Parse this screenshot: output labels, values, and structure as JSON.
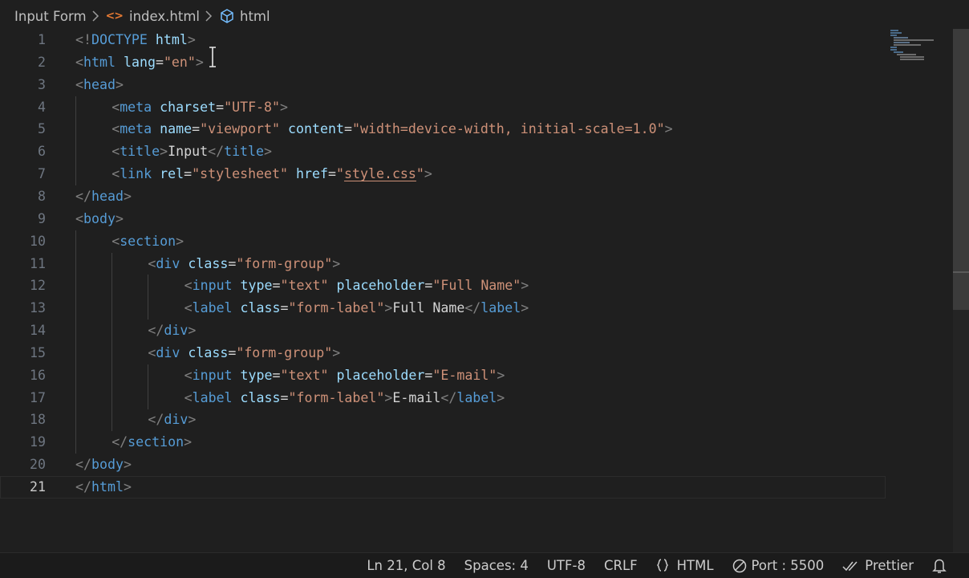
{
  "breadcrumb": {
    "folder": "Input Form",
    "file": "index.html",
    "file_icon": "<>",
    "symbol": "html"
  },
  "editor": {
    "current_line": 21,
    "lines": [
      {
        "n": "1",
        "indent": 0,
        "tokens": [
          {
            "c": "t",
            "v": "<!"
          },
          {
            "c": "dt",
            "v": "DOCTYPE"
          },
          {
            "c": "x",
            "v": " "
          },
          {
            "c": "a",
            "v": "html"
          },
          {
            "c": "t",
            "v": ">"
          }
        ]
      },
      {
        "n": "2",
        "indent": 0,
        "tokens": [
          {
            "c": "t",
            "v": "<"
          },
          {
            "c": "k",
            "v": "html"
          },
          {
            "c": "x",
            "v": " "
          },
          {
            "c": "a",
            "v": "lang"
          },
          {
            "c": "e",
            "v": "="
          },
          {
            "c": "s",
            "v": "\"en\""
          },
          {
            "c": "t",
            "v": ">"
          }
        ]
      },
      {
        "n": "3",
        "indent": 0,
        "tokens": [
          {
            "c": "t",
            "v": "<"
          },
          {
            "c": "k",
            "v": "head"
          },
          {
            "c": "t",
            "v": ">"
          }
        ]
      },
      {
        "n": "4",
        "indent": 1,
        "tokens": [
          {
            "c": "t",
            "v": "<"
          },
          {
            "c": "k",
            "v": "meta"
          },
          {
            "c": "x",
            "v": " "
          },
          {
            "c": "a",
            "v": "charset"
          },
          {
            "c": "e",
            "v": "="
          },
          {
            "c": "s",
            "v": "\"UTF-8\""
          },
          {
            "c": "t",
            "v": ">"
          }
        ]
      },
      {
        "n": "5",
        "indent": 1,
        "tokens": [
          {
            "c": "t",
            "v": "<"
          },
          {
            "c": "k",
            "v": "meta"
          },
          {
            "c": "x",
            "v": " "
          },
          {
            "c": "a",
            "v": "name"
          },
          {
            "c": "e",
            "v": "="
          },
          {
            "c": "s",
            "v": "\"viewport\""
          },
          {
            "c": "x",
            "v": " "
          },
          {
            "c": "a",
            "v": "content"
          },
          {
            "c": "e",
            "v": "="
          },
          {
            "c": "s",
            "v": "\"width=device-width, initial-scale=1.0\""
          },
          {
            "c": "t",
            "v": ">"
          }
        ]
      },
      {
        "n": "6",
        "indent": 1,
        "tokens": [
          {
            "c": "t",
            "v": "<"
          },
          {
            "c": "k",
            "v": "title"
          },
          {
            "c": "t",
            "v": ">"
          },
          {
            "c": "x",
            "v": "Input"
          },
          {
            "c": "t",
            "v": "</"
          },
          {
            "c": "k",
            "v": "title"
          },
          {
            "c": "t",
            "v": ">"
          }
        ]
      },
      {
        "n": "7",
        "indent": 1,
        "tokens": [
          {
            "c": "t",
            "v": "<"
          },
          {
            "c": "k",
            "v": "link"
          },
          {
            "c": "x",
            "v": " "
          },
          {
            "c": "a",
            "v": "rel"
          },
          {
            "c": "e",
            "v": "="
          },
          {
            "c": "s",
            "v": "\"stylesheet\""
          },
          {
            "c": "x",
            "v": " "
          },
          {
            "c": "a",
            "v": "href"
          },
          {
            "c": "e",
            "v": "="
          },
          {
            "c": "s",
            "v": "\""
          },
          {
            "c": "s u",
            "v": "style.css"
          },
          {
            "c": "s",
            "v": "\""
          },
          {
            "c": "t",
            "v": ">"
          }
        ]
      },
      {
        "n": "8",
        "indent": 0,
        "tokens": [
          {
            "c": "t",
            "v": "</"
          },
          {
            "c": "k",
            "v": "head"
          },
          {
            "c": "t",
            "v": ">"
          }
        ]
      },
      {
        "n": "9",
        "indent": 0,
        "tokens": [
          {
            "c": "t",
            "v": "<"
          },
          {
            "c": "k",
            "v": "body"
          },
          {
            "c": "t",
            "v": ">"
          }
        ]
      },
      {
        "n": "10",
        "indent": 1,
        "tokens": [
          {
            "c": "t",
            "v": "<"
          },
          {
            "c": "k",
            "v": "section"
          },
          {
            "c": "t",
            "v": ">"
          }
        ]
      },
      {
        "n": "11",
        "indent": 2,
        "tokens": [
          {
            "c": "t",
            "v": "<"
          },
          {
            "c": "k",
            "v": "div"
          },
          {
            "c": "x",
            "v": " "
          },
          {
            "c": "a",
            "v": "class"
          },
          {
            "c": "e",
            "v": "="
          },
          {
            "c": "s",
            "v": "\"form-group\""
          },
          {
            "c": "t",
            "v": ">"
          }
        ]
      },
      {
        "n": "12",
        "indent": 3,
        "tokens": [
          {
            "c": "t",
            "v": "<"
          },
          {
            "c": "k",
            "v": "input"
          },
          {
            "c": "x",
            "v": " "
          },
          {
            "c": "a",
            "v": "type"
          },
          {
            "c": "e",
            "v": "="
          },
          {
            "c": "s",
            "v": "\"text\""
          },
          {
            "c": "x",
            "v": " "
          },
          {
            "c": "a",
            "v": "placeholder"
          },
          {
            "c": "e",
            "v": "="
          },
          {
            "c": "s",
            "v": "\"Full Name\""
          },
          {
            "c": "t",
            "v": ">"
          }
        ]
      },
      {
        "n": "13",
        "indent": 3,
        "tokens": [
          {
            "c": "t",
            "v": "<"
          },
          {
            "c": "k",
            "v": "label"
          },
          {
            "c": "x",
            "v": " "
          },
          {
            "c": "a",
            "v": "class"
          },
          {
            "c": "e",
            "v": "="
          },
          {
            "c": "s",
            "v": "\"form-label\""
          },
          {
            "c": "t",
            "v": ">"
          },
          {
            "c": "x",
            "v": "Full Name"
          },
          {
            "c": "t",
            "v": "</"
          },
          {
            "c": "k",
            "v": "label"
          },
          {
            "c": "t",
            "v": ">"
          }
        ]
      },
      {
        "n": "14",
        "indent": 2,
        "tokens": [
          {
            "c": "t",
            "v": "</"
          },
          {
            "c": "k",
            "v": "div"
          },
          {
            "c": "t",
            "v": ">"
          }
        ]
      },
      {
        "n": "15",
        "indent": 2,
        "tokens": [
          {
            "c": "t",
            "v": "<"
          },
          {
            "c": "k",
            "v": "div"
          },
          {
            "c": "x",
            "v": " "
          },
          {
            "c": "a",
            "v": "class"
          },
          {
            "c": "e",
            "v": "="
          },
          {
            "c": "s",
            "v": "\"form-group\""
          },
          {
            "c": "t",
            "v": ">"
          }
        ]
      },
      {
        "n": "16",
        "indent": 3,
        "tokens": [
          {
            "c": "t",
            "v": "<"
          },
          {
            "c": "k",
            "v": "input"
          },
          {
            "c": "x",
            "v": " "
          },
          {
            "c": "a",
            "v": "type"
          },
          {
            "c": "e",
            "v": "="
          },
          {
            "c": "s",
            "v": "\"text\""
          },
          {
            "c": "x",
            "v": " "
          },
          {
            "c": "a",
            "v": "placeholder"
          },
          {
            "c": "e",
            "v": "="
          },
          {
            "c": "s",
            "v": "\"E-mail\""
          },
          {
            "c": "t",
            "v": ">"
          }
        ]
      },
      {
        "n": "17",
        "indent": 3,
        "tokens": [
          {
            "c": "t",
            "v": "<"
          },
          {
            "c": "k",
            "v": "label"
          },
          {
            "c": "x",
            "v": " "
          },
          {
            "c": "a",
            "v": "class"
          },
          {
            "c": "e",
            "v": "="
          },
          {
            "c": "s",
            "v": "\"form-label\""
          },
          {
            "c": "t",
            "v": ">"
          },
          {
            "c": "x",
            "v": "E-mail"
          },
          {
            "c": "t",
            "v": "</"
          },
          {
            "c": "k",
            "v": "label"
          },
          {
            "c": "t",
            "v": ">"
          }
        ]
      },
      {
        "n": "18",
        "indent": 2,
        "tokens": [
          {
            "c": "t",
            "v": "</"
          },
          {
            "c": "k",
            "v": "div"
          },
          {
            "c": "t",
            "v": ">"
          }
        ]
      },
      {
        "n": "19",
        "indent": 1,
        "tokens": [
          {
            "c": "t",
            "v": "</"
          },
          {
            "c": "k",
            "v": "section"
          },
          {
            "c": "t",
            "v": ">"
          }
        ]
      },
      {
        "n": "20",
        "indent": 0,
        "tokens": [
          {
            "c": "t",
            "v": "</"
          },
          {
            "c": "k",
            "v": "body"
          },
          {
            "c": "t",
            "v": ">"
          }
        ]
      },
      {
        "n": "21",
        "indent": 0,
        "tokens": [
          {
            "c": "t",
            "v": "</"
          },
          {
            "c": "k",
            "v": "html"
          },
          {
            "c": "t",
            "v": ">"
          }
        ]
      }
    ]
  },
  "statusbar": {
    "position": "Ln 21, Col 8",
    "spaces": "Spaces: 4",
    "encoding": "UTF-8",
    "eol": "CRLF",
    "language": "HTML",
    "port": "Port : 5500",
    "formatter": "Prettier"
  },
  "colors": {
    "background": "#1f1f1f",
    "tag_bracket": "#808080",
    "tag_name": "#569cd6",
    "attribute": "#9cdcfe",
    "string": "#ce9178",
    "text": "#d4d4d4",
    "file_icon": "#e37933"
  },
  "icons": {
    "breadcrumb_separator": "chevron-right-icon",
    "file": "html-file-icon",
    "symbol": "cube-icon",
    "language": "braces-icon",
    "port": "no-entry-icon",
    "formatter": "double-check-icon",
    "notifications": "bell-icon"
  }
}
